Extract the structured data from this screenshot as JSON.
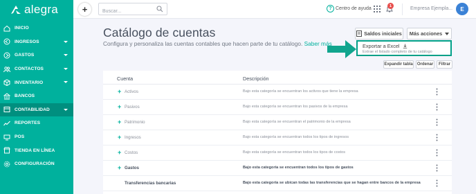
{
  "brand": {
    "logo_text": "alegra",
    "accent": "#00b19d",
    "accent_dark": "#008f7f"
  },
  "sidebar": {
    "items": [
      {
        "label": "INICIO",
        "icon": "home-icon",
        "has_caret": false,
        "active": false
      },
      {
        "label": "INGRESOS",
        "icon": "income-icon",
        "has_caret": true,
        "active": false
      },
      {
        "label": "GASTOS",
        "icon": "expense-icon",
        "has_caret": true,
        "active": false
      },
      {
        "label": "CONTACTOS",
        "icon": "contacts-icon",
        "has_caret": true,
        "active": false
      },
      {
        "label": "INVENTARIO",
        "icon": "box-icon",
        "has_caret": true,
        "active": false
      },
      {
        "label": "BANCOS",
        "icon": "bank-icon",
        "has_caret": false,
        "active": false
      },
      {
        "label": "CONTABILIDAD",
        "icon": "ledger-icon",
        "has_caret": true,
        "active": true
      },
      {
        "label": "REPORTES",
        "icon": "chart-line-icon",
        "has_caret": false,
        "active": false
      },
      {
        "label": "POS",
        "icon": "pos-icon",
        "has_caret": false,
        "active": false
      },
      {
        "label": "TIENDA EN LÍNEA",
        "icon": "store-icon",
        "has_caret": false,
        "active": false
      },
      {
        "label": "CONFIGURACIÓN",
        "icon": "gear-icon",
        "has_caret": false,
        "active": false
      }
    ]
  },
  "topbar": {
    "plus_label": "+",
    "search_placeholder": "Buscar...",
    "help_label": "Centro de ayuda",
    "notification_count": "1",
    "company": "Empresa Ejempla...",
    "avatar_initial": "E"
  },
  "page": {
    "title": "Catálogo de cuentas",
    "subtitle": "Configura y personaliza las cuentas contables que hacen parte de tu catálogo.",
    "subtitle_link": "Saber más",
    "saldos_label": "Saldos iniciales",
    "mas_acciones_label": "Más acciones",
    "dropdown": {
      "title": "Exportar a Excel",
      "subtitle": "Extrae el listado completo de tu catálogo"
    },
    "buttons": {
      "expandir": "Expandir tabla",
      "ordenar": "Ordenar",
      "filtrar": "Filtrar"
    }
  },
  "table": {
    "headers": {
      "cuenta": "Cuenta",
      "descripcion": "Descripción"
    },
    "rows": [
      {
        "name": "Activos",
        "desc": "Bajo esta categoría se encuentran los activos que tiene la empresa",
        "expandable": true,
        "bold": false
      },
      {
        "name": "Pasivos",
        "desc": "Bajo esta categoría se encuentran los pasivos de la empresa",
        "expandable": true,
        "bold": false
      },
      {
        "name": "Patrimonio",
        "desc": "Bajo esta categoría se encuentran el patrimonio de la empresa",
        "expandable": true,
        "bold": false
      },
      {
        "name": "Ingresos",
        "desc": "Bajo esta categoría se encuentran todos los tipos de ingresos",
        "expandable": true,
        "bold": false
      },
      {
        "name": "Costos",
        "desc": "Bajo esta categoría se encuentran todos los tipos de costos",
        "expandable": true,
        "bold": false
      },
      {
        "name": "Gastos",
        "desc": "Bajo esta categoría se encuentran todos los tipos de gastos",
        "expandable": true,
        "bold": true
      },
      {
        "name": "Transferencias bancarias",
        "desc": "Bajo esta categoría se ubican todas las transferencias que se hagan entre bancos de la empresa",
        "expandable": false,
        "bold": true
      }
    ]
  }
}
